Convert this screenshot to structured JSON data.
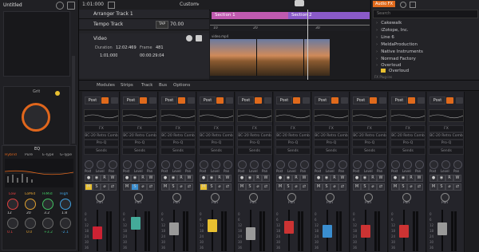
{
  "left_panel": {
    "title": "Untitled",
    "synth_label": "Grit",
    "eq_label": "EQ",
    "eq_modes": [
      "Hybrid",
      "Pure",
      "E-Type",
      "G-Type"
    ],
    "eq_bands": [
      "Low",
      "LoMid",
      "HiMid",
      "High"
    ],
    "eq_values": [
      "12",
      "20",
      "3.2",
      "1.8",
      "0.1",
      "0.0",
      "+3.2",
      "-2.1"
    ]
  },
  "topbar": {
    "time": "1:01:000",
    "preset": "Custom"
  },
  "tracks": {
    "arranger": "Arranger Track 1",
    "tempo": "Tempo Track",
    "tap": "TAP",
    "tempo_value": "70.00",
    "video": "Video",
    "duration_label": "Duration",
    "duration_value": "12:02:469",
    "frame_label": "Frame",
    "frame_value": "481",
    "timecode1": "1:01:000",
    "timecode2": "00:00:29:04"
  },
  "timeline": {
    "ruler": [
      "1",
      "5",
      "9"
    ],
    "markers": [
      "10",
      "20",
      "30"
    ],
    "sections": [
      "Section 1",
      "Section 2"
    ],
    "clip_name": "video.mp4"
  },
  "browser": {
    "tab": "Audio FX",
    "search_placeholder": "Search",
    "items": [
      "Cakewalk",
      "iZotope, Inc.",
      "Line 6",
      "MeldaProduction",
      "Native Instruments",
      "Normad Factory",
      "Overloud"
    ],
    "sub_item": "Overloud",
    "footer": "FX Plug-ins"
  },
  "console": {
    "menus": [
      "Modules",
      "Strips",
      "Track",
      "Bus",
      "Options"
    ],
    "strip_common": {
      "post": "Post",
      "fx": "FX",
      "eq_plugin": "BC-20 Retro Comb",
      "pro_q": "Pro-Q",
      "sends": "Sends",
      "labels": [
        "Post",
        "Level",
        "Pan"
      ],
      "pan": "Pan",
      "scale": [
        "0",
        "6",
        "12",
        "18",
        "24",
        "30",
        "36"
      ]
    },
    "strips": [
      {
        "num": "1",
        "color": "#c23",
        "state": "M"
      },
      {
        "num": "2",
        "color": "#4a9",
        "state": "S"
      },
      {
        "num": "3",
        "color": "#999",
        "state": ""
      },
      {
        "num": "4",
        "color": "#e8c030",
        "state": "M"
      },
      {
        "num": "5",
        "color": "#999",
        "state": ""
      },
      {
        "num": "6",
        "color": "#c33",
        "state": ""
      },
      {
        "num": "7",
        "color": "#3a8ed0",
        "state": ""
      },
      {
        "num": "8",
        "color": "#c33",
        "state": ""
      },
      {
        "num": "9",
        "color": "#c33",
        "state": ""
      },
      {
        "num": "10",
        "color": "#999",
        "state": ""
      }
    ]
  }
}
